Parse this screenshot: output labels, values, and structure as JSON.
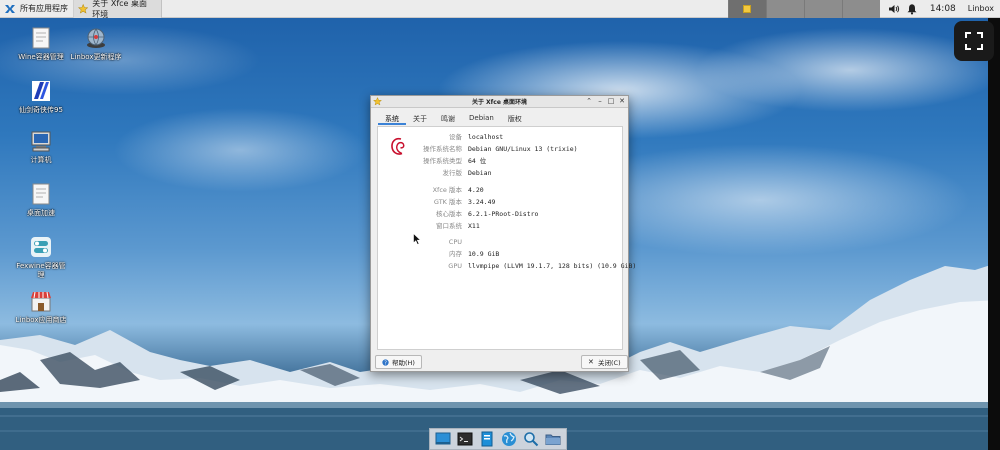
{
  "panel": {
    "app_menu_label": "所有应用程序",
    "task_title": "关于 Xfce 桌面环境",
    "clock": "14:08",
    "user": "Linbox",
    "tray_icons": [
      "volume-icon",
      "notification-bell-icon"
    ],
    "workspaces": 4
  },
  "desktop_icons": [
    {
      "label": "Wine容器管理",
      "icon": "document-icon"
    },
    {
      "label": "Linbox更新程序",
      "icon": "globe-update-icon"
    },
    {
      "label": "仙剑奇侠传95",
      "icon": "game-icon"
    },
    {
      "label": "计算机",
      "icon": "computer-icon"
    },
    {
      "label": "桌面加速",
      "icon": "document-icon"
    },
    {
      "label": "Fexwine容器管理",
      "icon": "toggle-app-icon"
    },
    {
      "label": "Linbox应用商店",
      "icon": "store-icon"
    }
  ],
  "dialog": {
    "title": "关于 Xfce 桌面环境",
    "tabs": [
      "系统",
      "关于",
      "鸣谢",
      "Debian",
      "版权"
    ],
    "active_tab": "系统",
    "rows": [
      {
        "key": "设备",
        "value": "localhost"
      },
      {
        "key": "操作系统名称",
        "value": "Debian GNU/Linux 13 (trixie)"
      },
      {
        "key": "操作系统类型",
        "value": "64 位"
      },
      {
        "key": "发行版",
        "value": "Debian"
      },
      {
        "key": "Xfce 版本",
        "value": "4.20"
      },
      {
        "key": "GTK 版本",
        "value": "3.24.49"
      },
      {
        "key": "核心版本",
        "value": "6.2.1-PRoot-Distro"
      },
      {
        "key": "窗口系统",
        "value": "X11"
      },
      {
        "key": "CPU",
        "value": ""
      },
      {
        "key": "内存",
        "value": "10.9 GiB"
      },
      {
        "key": "GPU",
        "value": "llvmpipe (LLVM 19.1.7, 128 bits) (10.9 GiB)"
      }
    ],
    "help_label": "帮助(H)",
    "close_label": "关闭(C)"
  },
  "dock": [
    "desktop-icon",
    "terminal-icon",
    "file-manager-icon",
    "browser-icon",
    "search-icon",
    "folder-icon"
  ],
  "colors": {
    "accent": "#3b82d6",
    "panel_bg": "#ececec",
    "workspace_bg": "#8d8d8d",
    "dialog_bg": "#efefef"
  }
}
